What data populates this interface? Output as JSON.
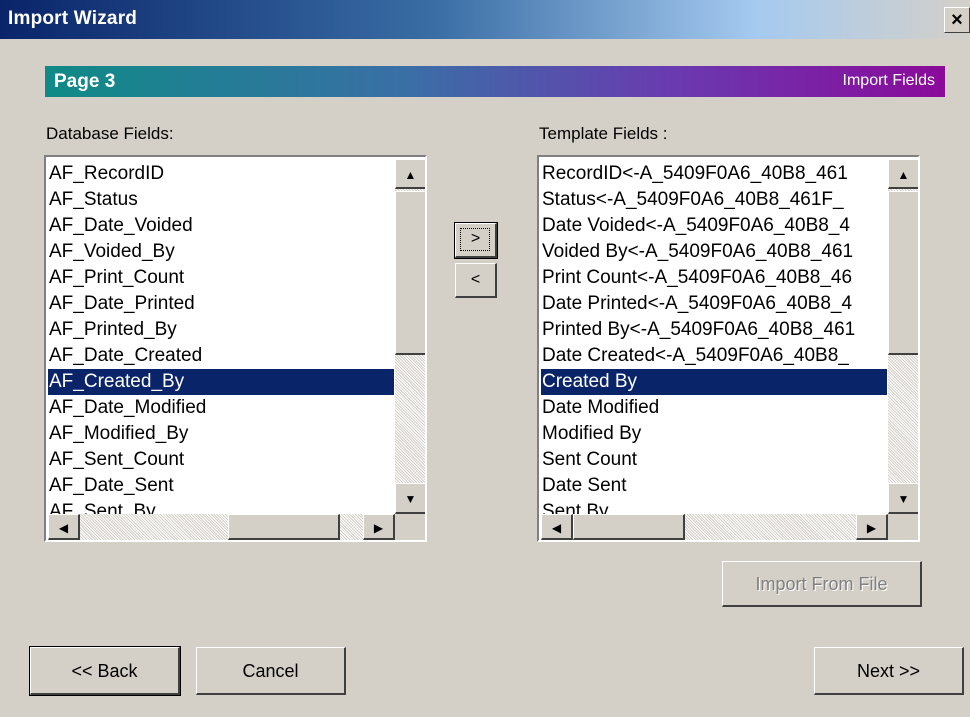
{
  "window": {
    "title": "Import Wizard",
    "close_label": "×"
  },
  "banner": {
    "page": "Page 3",
    "section": "Import Fields"
  },
  "database_fields": {
    "label": "Database Fields:",
    "items": [
      "AF_RecordID",
      "AF_Status",
      "AF_Date_Voided",
      "AF_Voided_By",
      "AF_Print_Count",
      "AF_Date_Printed",
      "AF_Printed_By",
      "AF_Date_Created",
      "AF_Created_By",
      "AF_Date_Modified",
      "AF_Modified_By",
      "AF_Sent_Count",
      "AF_Date_Sent",
      "AF_Sent_By"
    ],
    "selected": "AF_Created_By"
  },
  "template_fields": {
    "label": "Template Fields :",
    "items": [
      "RecordID<-A_5409F0A6_40B8_461",
      "Status<-A_5409F0A6_40B8_461F_",
      "Date Voided<-A_5409F0A6_40B8_4",
      "Voided By<-A_5409F0A6_40B8_461",
      "Print Count<-A_5409F0A6_40B8_46",
      "Date Printed<-A_5409F0A6_40B8_4",
      "Printed By<-A_5409F0A6_40B8_461",
      "Date Created<-A_5409F0A6_40B8_",
      "Created By",
      "Date Modified",
      "Modified By",
      "Sent Count",
      "Date Sent",
      "Sent By"
    ],
    "selected": "Created By"
  },
  "move_buttons": {
    "add": ">",
    "remove": "<"
  },
  "buttons": {
    "import_file": "Import From File",
    "back": "<< Back",
    "cancel": "Cancel",
    "next": "Next >>"
  },
  "scroll_glyphs": {
    "up": "▲",
    "down": "▼",
    "left": "◀",
    "right": "▶"
  }
}
